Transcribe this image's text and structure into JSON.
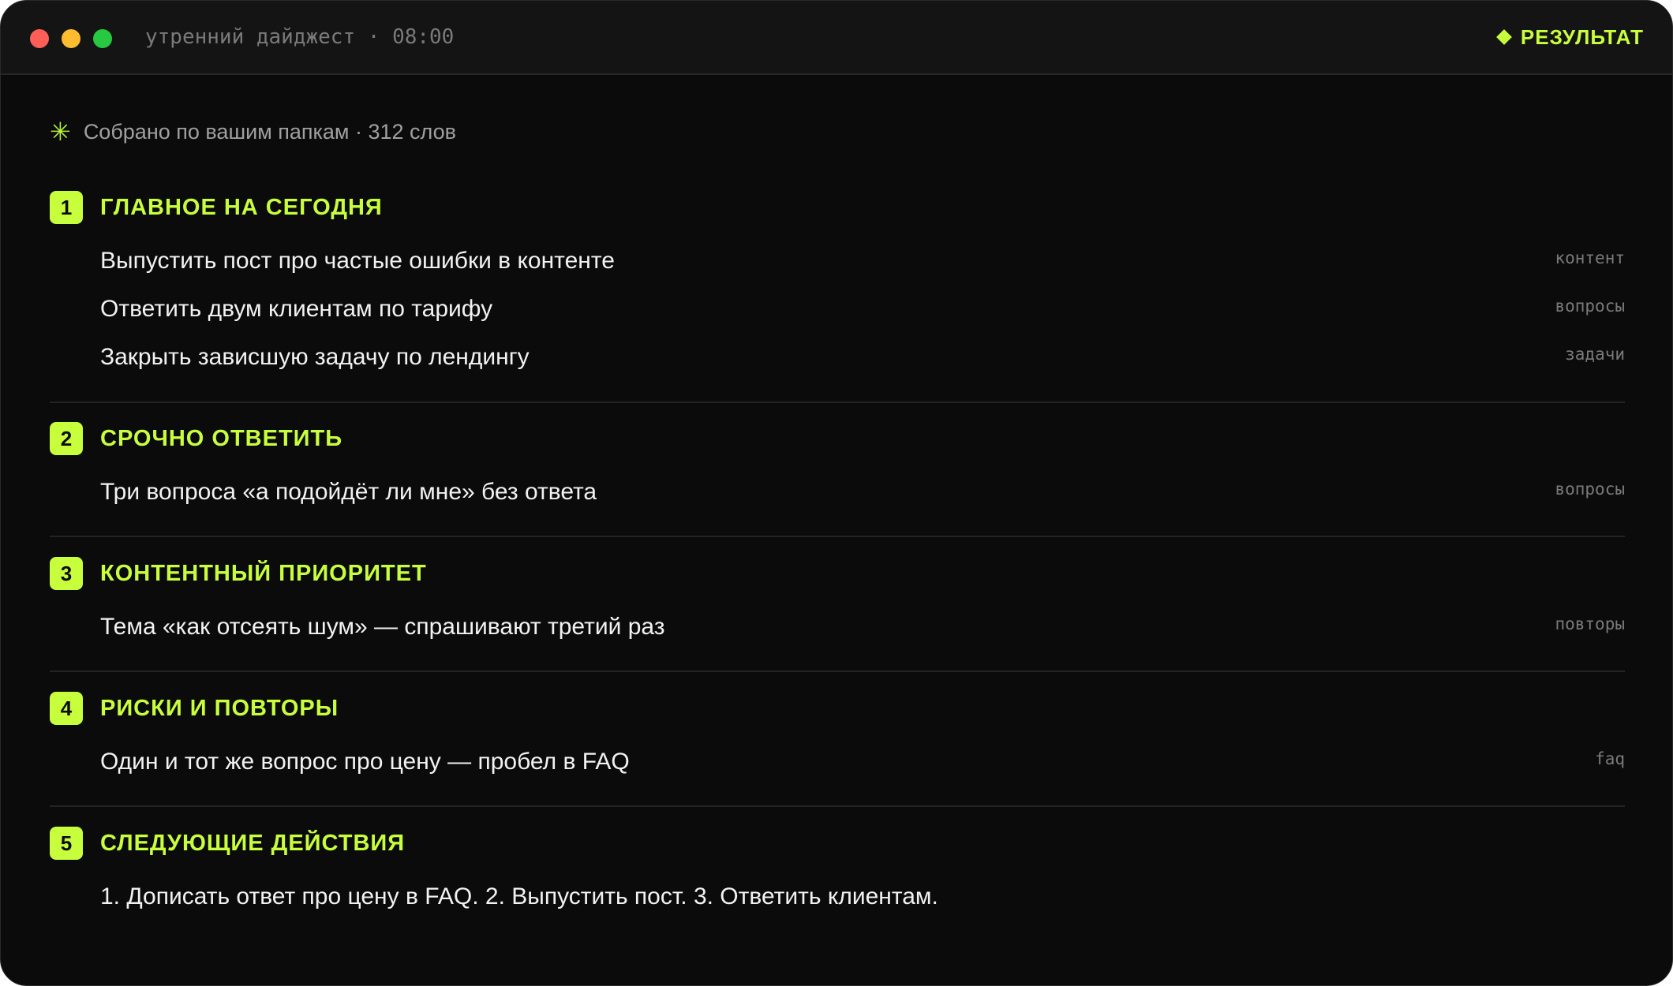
{
  "window": {
    "title": "утренний дайджест · 08:00",
    "result_label": "РЕЗУЛЬТАТ",
    "colors": {
      "accent": "#c8ff3c",
      "background": "#0b0b0b"
    }
  },
  "summary": {
    "icon": "asterisk-icon",
    "text": "Собрано по вашим папкам · 312 слов"
  },
  "sections": [
    {
      "number": "1",
      "title": "ГЛАВНОЕ НА СЕГОДНЯ",
      "items": [
        {
          "text": "Выпустить пост про частые ошибки в контенте",
          "tag": "контент"
        },
        {
          "text": "Ответить двум клиентам по тарифу",
          "tag": "вопросы"
        },
        {
          "text": "Закрыть зависшую задачу по лендингу",
          "tag": "задачи"
        }
      ]
    },
    {
      "number": "2",
      "title": "СРОЧНО ОТВЕТИТЬ",
      "items": [
        {
          "text": "Три вопроса «а подойдёт ли мне» без ответа",
          "tag": "вопросы"
        }
      ]
    },
    {
      "number": "3",
      "title": "КОНТЕНТНЫЙ ПРИОРИТЕТ",
      "items": [
        {
          "text": "Тема «как отсеять шум» — спрашивают третий раз",
          "tag": "повторы"
        }
      ]
    },
    {
      "number": "4",
      "title": "РИСКИ И ПОВТОРЫ",
      "items": [
        {
          "text": "Один и тот же вопрос про цену — пробел в FAQ",
          "tag": "faq"
        }
      ]
    },
    {
      "number": "5",
      "title": "СЛЕДУЮЩИЕ ДЕЙСТВИЯ",
      "items": [
        {
          "text": "1. Дописать ответ про цену в FAQ. 2. Выпустить пост. 3. Ответить клиентам.",
          "tag": ""
        }
      ]
    }
  ]
}
